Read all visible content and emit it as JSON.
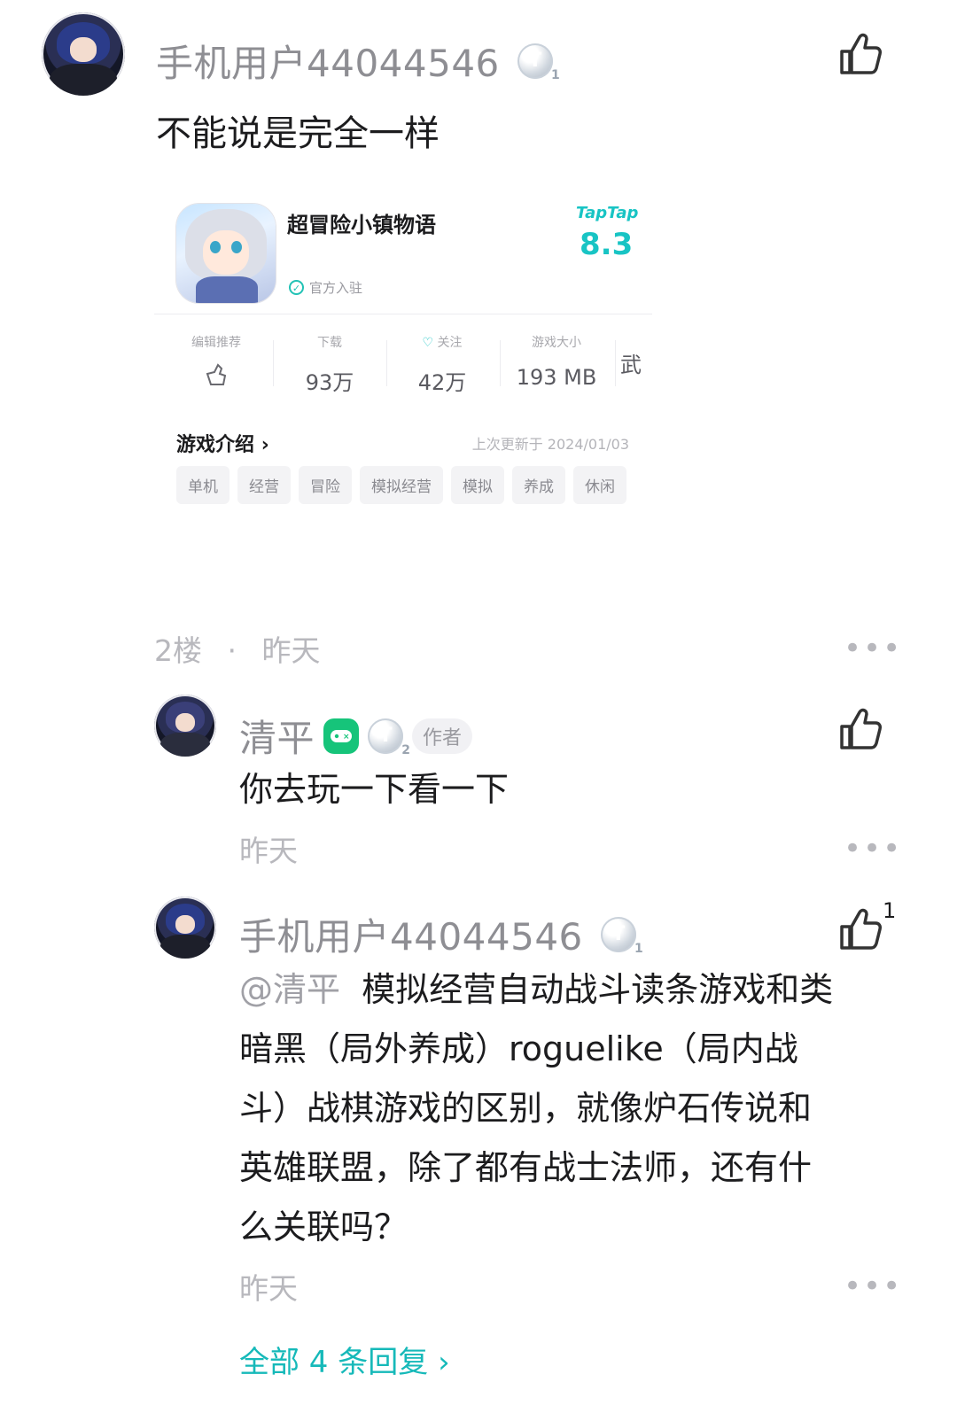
{
  "post": {
    "username": "手机用户44044546",
    "badge_letter": "T",
    "badge_level": "1",
    "text": "不能说是完全一样"
  },
  "game_card": {
    "name": "超冒险小镇物语",
    "verified_label": "官方入驻",
    "platform_logo": "TapTap",
    "score": "8.3",
    "stats": [
      {
        "label": "编辑推荐",
        "value": ""
      },
      {
        "label": "下载",
        "value": "93万"
      },
      {
        "label": "关注",
        "value": "42万"
      },
      {
        "label": "游戏大小",
        "value": "193 MB"
      },
      {
        "label": "",
        "value": "武"
      }
    ],
    "intro_label": "游戏介绍",
    "updated": "上次更新于 2024/01/03",
    "tags": [
      "单机",
      "经营",
      "冒险",
      "模拟经营",
      "模拟",
      "养成",
      "休闲"
    ]
  },
  "floor": {
    "number": "2楼",
    "separator": "·",
    "time": "昨天",
    "more": "•••"
  },
  "replies": [
    {
      "username": "清平",
      "badge_letter": "T",
      "badge_level": "2",
      "author_tag": "作者",
      "text": "你去玩一下看一下",
      "time": "昨天",
      "more": "•••"
    },
    {
      "username": "手机用户44044546",
      "badge_letter": "T",
      "badge_level": "1",
      "mention": "@清平",
      "text_lines": [
        "模拟经营自动战斗读条游戏和类",
        "暗黑（局外养成）roguelike（局内战",
        "斗）战棋游戏的区别，就像炉石传说和",
        "英雄联盟，除了都有战士法师，还有什",
        "么关联吗？"
      ],
      "time": "昨天",
      "more": "•••",
      "like_count": "1"
    }
  ],
  "all_replies": "全部 4 条回复",
  "colors": {
    "accent": "#16b9b9",
    "muted": "#8e8e93",
    "badge_green": "#16c47a"
  }
}
